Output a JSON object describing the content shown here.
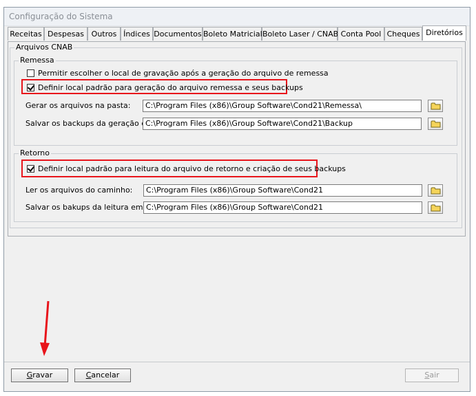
{
  "window": {
    "title": "Configuração do Sistema"
  },
  "tabs": [
    {
      "label": "Receitas"
    },
    {
      "label": "Despesas"
    },
    {
      "label": "Outros"
    },
    {
      "label": "Índices"
    },
    {
      "label": "Documentos"
    },
    {
      "label": "Boleto Matricial"
    },
    {
      "label": "Boleto Laser / CNAB"
    },
    {
      "label": "Conta Pool"
    },
    {
      "label": "Cheques"
    },
    {
      "label": "Diretórios",
      "active": true
    }
  ],
  "arquivos_cnab": {
    "label": "Arquivos CNAB",
    "remessa": {
      "label": "Remessa",
      "permitir": {
        "label": "Permitir escolher o local de gravação após a geração do arquivo de remessa",
        "checked": false
      },
      "definir": {
        "label": "Definir local padrão para geração do arquivo remessa e seus backups",
        "checked": true
      },
      "gerar_label": "Gerar os arquivos na pasta:",
      "gerar_value": "C:\\Program Files (x86)\\Group Software\\Cond21\\Remessa\\",
      "salvar_label": "Salvar os backups da geração em:",
      "salvar_value": "C:\\Program Files (x86)\\Group Software\\Cond21\\Backup"
    },
    "retorno": {
      "label": "Retorno",
      "definir": {
        "label": "Definir local padrão para leitura do arquivo de retorno e criação de seus backups",
        "checked": true
      },
      "ler_label": "Ler os arquivos do caminho:",
      "ler_value": "C:\\Program Files (x86)\\Group Software\\Cond21",
      "salvar_label": "Salvar os bakups da leitura em:",
      "salvar_value": "C:\\Program Files (x86)\\Group Software\\Cond21"
    }
  },
  "buttons": {
    "gravar": {
      "first": "G",
      "rest": "ravar"
    },
    "cancelar": {
      "first": "C",
      "rest": "ancelar"
    },
    "sair": {
      "first": "S",
      "rest": "air"
    }
  },
  "colors": {
    "highlight": "#e8141b",
    "arrow": "#e8141b"
  }
}
